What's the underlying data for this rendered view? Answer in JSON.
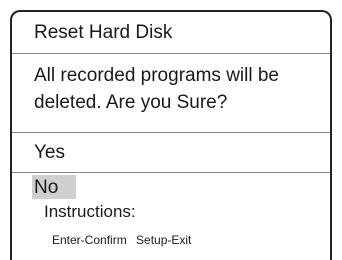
{
  "dialog": {
    "title": "Reset Hard Disk",
    "message_line1": "All recorded programs will be",
    "message_line2": "deleted. Are you Sure?",
    "options": [
      {
        "label": "Yes",
        "selected": false
      },
      {
        "label": "No",
        "selected": true
      }
    ],
    "instructions": {
      "title": "Instructions:",
      "confirm_hint": "Enter-Confirm",
      "exit_hint": "Setup-Exit"
    }
  },
  "colors": {
    "border": "#222222",
    "divider": "#8a8a8a",
    "selection_highlight": "#cfcfcf",
    "text": "#1a1a1a",
    "background": "#ffffff"
  }
}
